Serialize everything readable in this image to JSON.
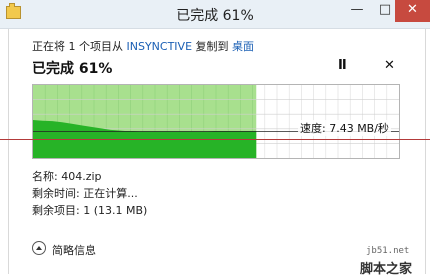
{
  "window": {
    "title": "已完成 61%",
    "minimize_label": "—",
    "maximize_label": "□",
    "close_label": "✕"
  },
  "copy": {
    "prefix": "正在将 1 个项目从 ",
    "source": "INSYNCTIVE",
    "middle": " 复制到 ",
    "destination": "桌面",
    "progress_label": "已完成 61%",
    "progress_fraction": 0.61,
    "pause_label": "II",
    "cancel_label": "✕"
  },
  "chart_data": {
    "type": "area",
    "title": "",
    "xlabel": "",
    "ylabel": "",
    "annotation": "速度: 7.43 MB/秒",
    "progress_fraction": 0.61,
    "speed_mb_s": 7.43,
    "series": [
      {
        "values": [
          1.0,
          0.98,
          0.97,
          0.94,
          0.9,
          0.86,
          0.82,
          0.78,
          0.74,
          0.72,
          0.7,
          0.69,
          0.69,
          0.69,
          0.69,
          0.69,
          0.69,
          0.69,
          0.69,
          0.7,
          0.7,
          0.7,
          0.7,
          0.7
        ]
      }
    ],
    "grid": true,
    "colors": {
      "fill": "#27b327",
      "background_done": "#a8e08e",
      "grid": "#8fd07a"
    }
  },
  "details": {
    "name_label": "名称:",
    "name_value": "404.zip",
    "time_label": "剩余时间:",
    "time_value": "正在计算...",
    "items_label": "剩余项目:",
    "items_value": "1 (13.1 MB)"
  },
  "footer": {
    "collapse_label": "简略信息"
  },
  "watermark": {
    "site": "jb51.net",
    "brand": "脚本之家"
  }
}
